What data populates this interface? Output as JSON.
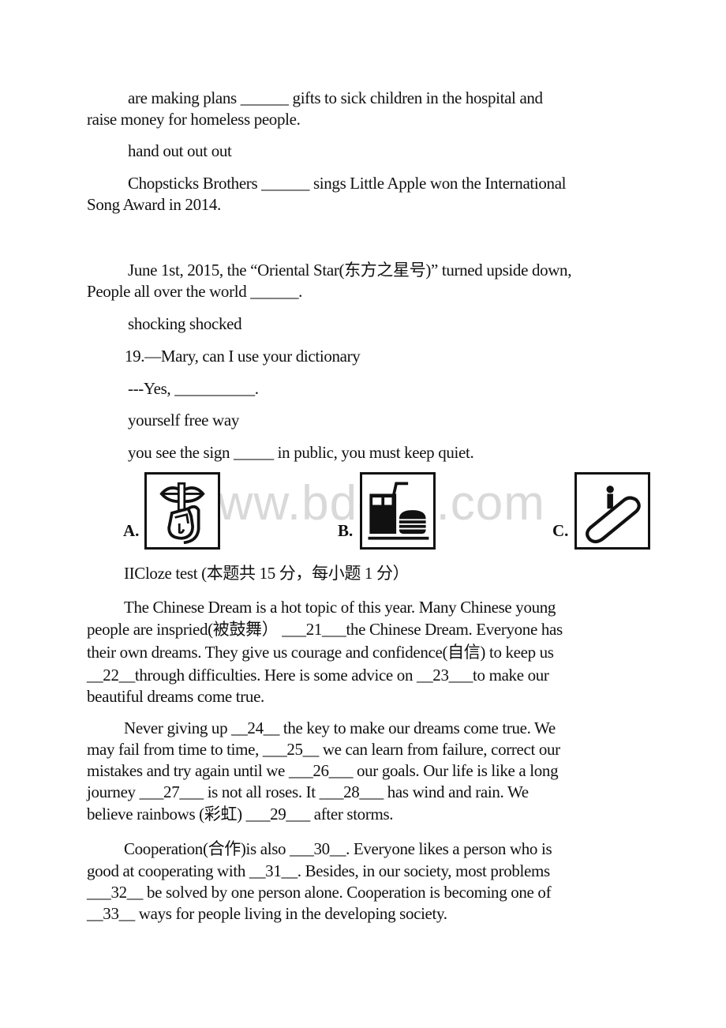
{
  "document": {
    "lines": {
      "q_plans_1": "are making plans ______ gifts to sick children in the hospital and",
      "q_plans_2": "raise money for homeless people.",
      "q_plans_options": "hand out out out",
      "q_chopsticks_1": "Chopsticks Brothers ______ sings Little Apple won the International",
      "q_chopsticks_2": "Song Award in 2014.",
      "q_star_1": "June 1st, 2015, the “Oriental Star(东方之星号)” turned upside down,",
      "q_star_2": "People all over the world ______.",
      "q_star_options": "shocking shocked",
      "q19_question": "19.—Mary, can I use your dictionary",
      "q19_answer": "---Yes, __________.",
      "q19_options": "yourself free way",
      "q_sign": "you see the sign _____ in public, you must keep quiet."
    },
    "signs": {
      "watermark": "www.bdocx.com",
      "options": [
        {
          "label": "A.",
          "icon": "keep-quiet-sign-icon"
        },
        {
          "label": "B.",
          "icon": "fast-food-sign-icon"
        },
        {
          "label": "C.",
          "icon": "escalator-sign-icon"
        }
      ]
    },
    "section_heading": "IICloze test (本题共 15 分，每小题 1 分）",
    "passage": {
      "p1": [
        "The Chinese Dream is a hot topic of this year. Many Chinese young",
        "people are inspried(被鼓舞） ___21___the Chinese Dream. Everyone has",
        "their own dreams. They give us courage and confidence(自信) to keep us",
        "__22__through difficulties. Here is some advice on __23___to make our",
        "beautiful dreams come true."
      ],
      "p2": [
        "Never giving up __24__ the key to make our dreams come true. We",
        "may fail from time to time, ___25__ we can learn from failure, correct our",
        "mistakes and try again until we ___26___ our goals. Our life is like a long",
        "journey ___27___ is not all roses. It ___28___ has wind and rain. We",
        "believe rainbows (彩虹) ___29___ after storms."
      ],
      "p3": [
        "Cooperation(合作)is also ___30__. Everyone likes a person who is",
        "good at cooperating with __31__. Besides, in our society, most problems",
        "___32__ be solved by one person alone. Cooperation is becoming one of",
        "__33__  ways for people living in the developing society."
      ]
    }
  }
}
